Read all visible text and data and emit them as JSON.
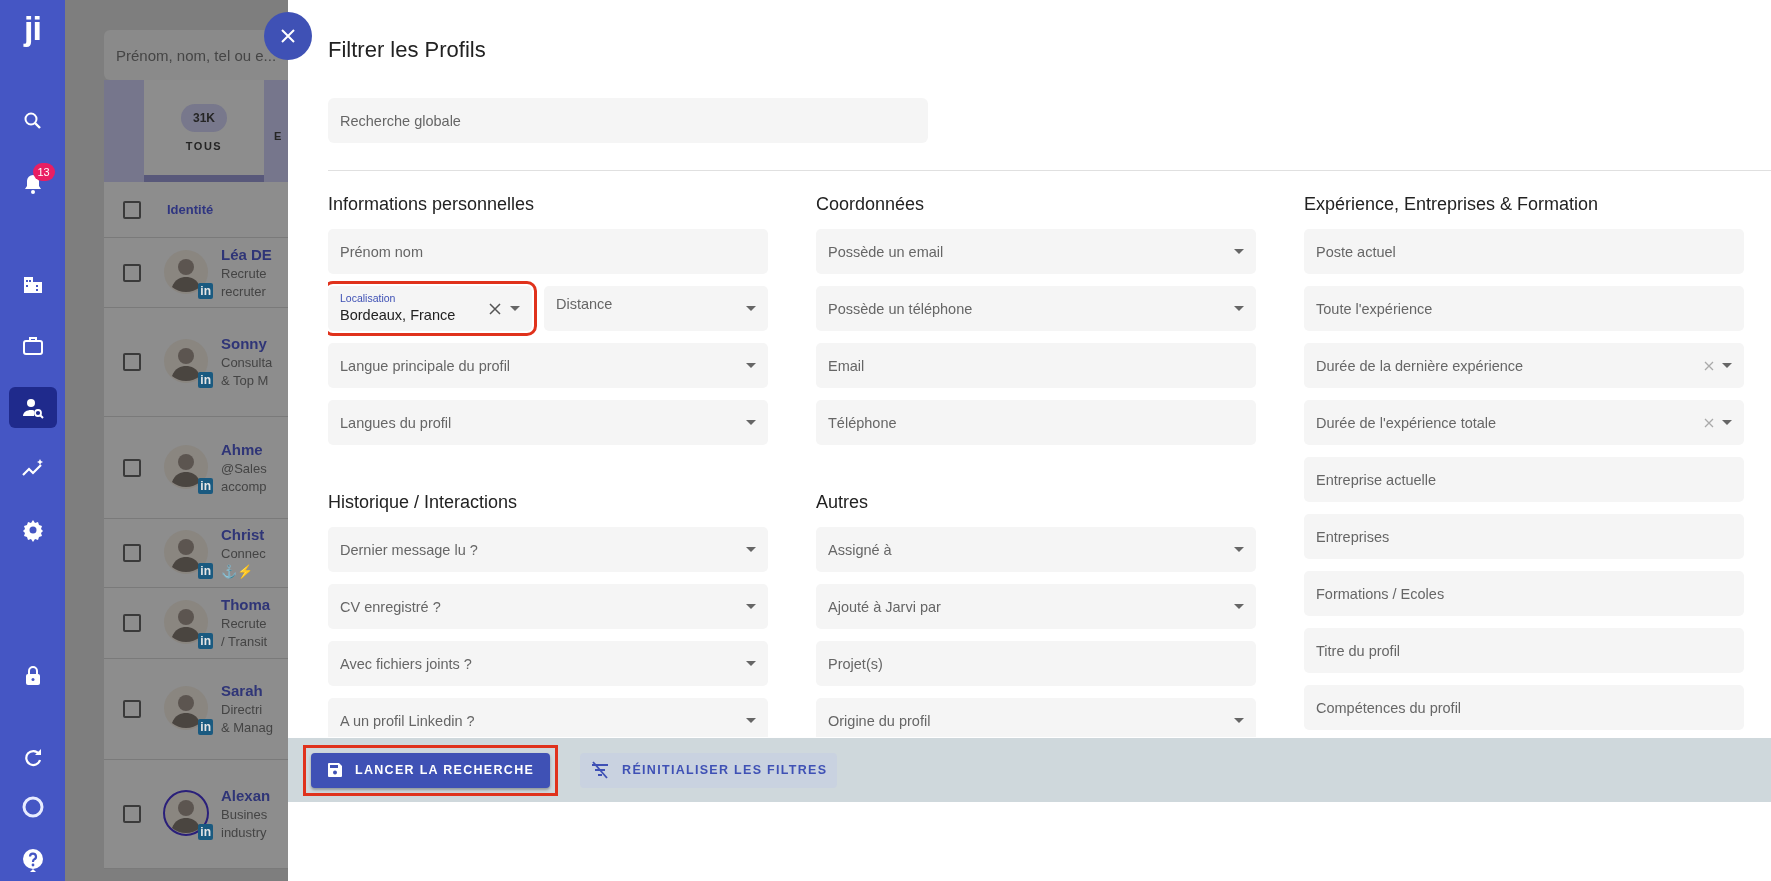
{
  "sidebar": {
    "logo": "ji",
    "items": [
      {
        "selected": false
      },
      {
        "selected": false,
        "badge": "13"
      },
      {
        "selected": false
      },
      {
        "selected": false
      },
      {
        "selected": true
      },
      {
        "selected": false
      },
      {
        "selected": false
      },
      {
        "selected": false
      },
      {
        "selected": false
      },
      {
        "selected": false
      },
      {
        "selected": false
      }
    ]
  },
  "profiles_list": {
    "search": {
      "placeholder": "Prénom, nom, tel ou e..."
    },
    "tabs": [
      {
        "count": "31K",
        "label": "TOUS",
        "selected": true
      },
      {
        "label": "E",
        "selected": false
      }
    ],
    "header": {
      "checked": false,
      "column": "Identité"
    },
    "rows": [
      {
        "checked": false,
        "name": "Léa DE",
        "lines": [
          "Recrute",
          "recruter"
        ],
        "badge": "in",
        "ring": false
      },
      {
        "checked": false,
        "name": "Sonny",
        "lines": [
          "Consulta",
          "& Top M"
        ],
        "badge": "in",
        "ring": false
      },
      {
        "checked": false,
        "name": "Ahme",
        "lines": [
          "@Sales",
          "accomp"
        ],
        "badge": "in",
        "ring": false
      },
      {
        "checked": false,
        "name": "Christ",
        "lines": [
          "Connec",
          "⚓⚡"
        ],
        "badge": "in",
        "ring": false
      },
      {
        "checked": false,
        "name": "Thoma",
        "lines": [
          "Recrute",
          "/ Transit"
        ],
        "badge": "in",
        "ring": false
      },
      {
        "checked": false,
        "name": "Sarah",
        "lines": [
          "Directri",
          "& Manag"
        ],
        "badge": "in",
        "ring": false
      },
      {
        "checked": false,
        "name": "Alexan",
        "lines": [
          "Busines",
          "industry"
        ],
        "badge": "in",
        "ring": true
      }
    ]
  },
  "filter_panel": {
    "title": "Filtrer les Profils",
    "global_search": {
      "placeholder": "Recherche globale"
    },
    "columns": [
      {
        "sections": [
          {
            "heading": "Informations personnelles",
            "fields": [
              {
                "kind": "text",
                "placeholder": "Prénom nom"
              },
              {
                "kind": "pair",
                "items": [
                  {
                    "kind": "select",
                    "label": "Localisation",
                    "value": "Bordeaux, France",
                    "clearable": true,
                    "highlighted": true
                  },
                  {
                    "kind": "select",
                    "placeholder": "Distance",
                    "clearable": false,
                    "highlighted": false
                  }
                ]
              },
              {
                "kind": "select",
                "placeholder": "Langue principale du profil",
                "clearable": false
              },
              {
                "kind": "select",
                "placeholder": "Langues du profil",
                "clearable": false
              }
            ]
          },
          {
            "heading": "Historique / Interactions",
            "fields": [
              {
                "kind": "select",
                "placeholder": "Dernier message lu ?",
                "clearable": false
              },
              {
                "kind": "select",
                "placeholder": "CV enregistré ?",
                "clearable": false
              },
              {
                "kind": "select",
                "placeholder": "Avec fichiers joints ?",
                "clearable": false
              },
              {
                "kind": "select",
                "placeholder": "A un profil Linkedin ?",
                "clearable": false
              }
            ]
          }
        ]
      },
      {
        "sections": [
          {
            "heading": "Coordonnées",
            "fields": [
              {
                "kind": "select",
                "placeholder": "Possède un email",
                "clearable": false
              },
              {
                "kind": "select",
                "placeholder": "Possède un téléphone",
                "clearable": false
              },
              {
                "kind": "text",
                "placeholder": "Email"
              },
              {
                "kind": "text",
                "placeholder": "Téléphone"
              }
            ]
          },
          {
            "heading": "Autres",
            "fields": [
              {
                "kind": "select",
                "placeholder": "Assigné à",
                "clearable": false
              },
              {
                "kind": "select",
                "placeholder": "Ajouté à Jarvi par",
                "clearable": false
              },
              {
                "kind": "text",
                "placeholder": "Projet(s)"
              },
              {
                "kind": "select",
                "placeholder": "Origine du profil",
                "clearable": false
              }
            ]
          }
        ]
      },
      {
        "sections": [
          {
            "heading": "Expérience, Entreprises & Formation",
            "fields": [
              {
                "kind": "text",
                "placeholder": "Poste actuel"
              },
              {
                "kind": "text",
                "placeholder": "Toute l'expérience"
              },
              {
                "kind": "select",
                "placeholder": "Durée de la dernière expérience",
                "clearable": true
              },
              {
                "kind": "select",
                "placeholder": "Durée de l'expérience totale",
                "clearable": true
              },
              {
                "kind": "text",
                "placeholder": "Entreprise actuelle"
              },
              {
                "kind": "text",
                "placeholder": "Entreprises"
              },
              {
                "kind": "text",
                "placeholder": "Formations / Ecoles"
              },
              {
                "kind": "text",
                "placeholder": "Titre du profil"
              },
              {
                "kind": "text",
                "placeholder": "Compétences du profil"
              }
            ]
          }
        ]
      }
    ],
    "buttons": [
      {
        "kind": "primary",
        "label": "LANCER LA RECHERCHE",
        "highlighted": true
      },
      {
        "kind": "secondary",
        "label": "RÉINITIALISER LES FILTRES",
        "highlighted": false
      }
    ]
  }
}
